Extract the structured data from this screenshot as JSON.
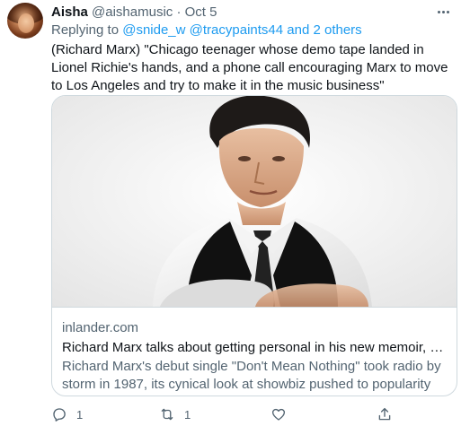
{
  "tweet": {
    "author_name": "Aisha",
    "author_handle": "@aishamusic",
    "separator": "·",
    "timestamp": "Oct 5",
    "replying_prefix": "Replying to",
    "replying_to": [
      "@snide_w",
      "@tracypaints44"
    ],
    "replying_and": "and 2 others",
    "text": "(Richard Marx) \"Chicago teenager whose demo tape landed in Lionel Richie's hands, and a phone call encouraging Marx to move to Los Angeles and try to make it in the music business\""
  },
  "card": {
    "image_alt": "Richard Marx portrait, arms crossed, white shirt, black vest and tie",
    "domain": "inlander.com",
    "title": "Richard Marx talks about getting personal in his new memoir, pandemi...",
    "description": "Richard Marx's debut single \"Don't Mean Nothing\" took radio by storm in 1987, its cynical look at showbiz pushed to popularity with the help ..."
  },
  "actions": {
    "reply_icon": "reply-icon",
    "reply_count": "1",
    "retweet_icon": "retweet-icon",
    "retweet_count": "1",
    "like_icon": "heart-icon",
    "share_icon": "share-icon"
  },
  "colors": {
    "accent": "#1d9bf0",
    "secondary_text": "#536471",
    "border": "#cfd9de"
  }
}
